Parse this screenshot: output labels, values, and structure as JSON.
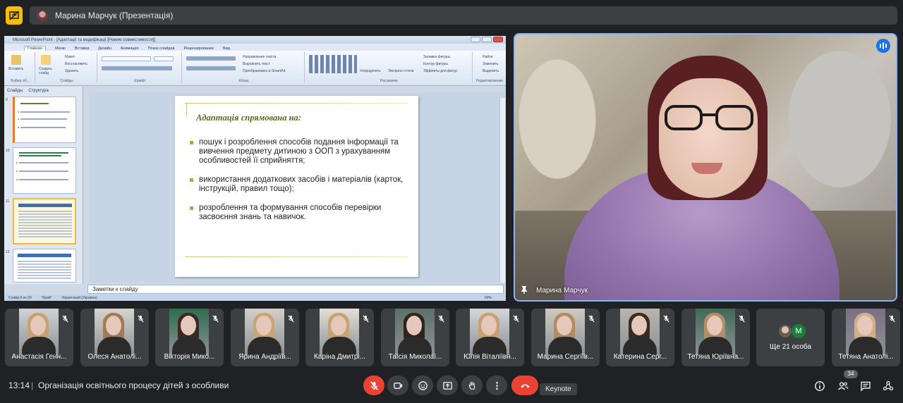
{
  "top_bar": {
    "presenter_title": "Марина Марчук (Презентація)"
  },
  "presentation": {
    "app_title": "Microsoft PowerPoint - [Адаптації та модифікації [Режим совместимости]]",
    "tabs": [
      "Главная",
      "Меню",
      "Вставка",
      "Дизайн",
      "Анимация",
      "Показ слайдов",
      "Рецензирование",
      "Вид"
    ],
    "ribbon": {
      "paste": "Вставить",
      "clipboard": "Буфер об...",
      "new_slide": "Создать слайд",
      "layout": "Макет",
      "reset": "Восстановить",
      "delete": "Удалить",
      "slides_group": "Слайды",
      "font_group": "Шрифт",
      "paragraph_group": "Абзац",
      "text_direction": "Направление текста",
      "align_text": "Выровнять текст",
      "smartart": "Преобразовать в SmartArt",
      "arrange": "Упорядочить",
      "quick_styles": "Экспресс-стили",
      "shape_fill": "Заливка фигуры",
      "shape_outline": "Контур фигуры",
      "shape_effects": "Эффекты для фигур",
      "drawing_group": "Рисование",
      "find": "Найти",
      "replace": "Заменить",
      "select": "Выделить",
      "editing_group": "Редактирование"
    },
    "pane_tabs": [
      "Слайды",
      "Структура"
    ],
    "thumb_numbers": [
      "9",
      "10",
      "11",
      "12"
    ],
    "slide": {
      "heading": "Адаптація спрямована на:",
      "bullets": [
        "пошук і розроблення способів подання інформації та вивчення предмету дитиною з ООП з урахуванням особливостей її сприйняття;",
        "використання додаткових засобів і матеріалів (карток, інструкцій, правил тощо);",
        "розроблення та формування способів перевірки засвоєння знань та навичок."
      ]
    },
    "notes_placeholder": "Заметки к слайду",
    "status": {
      "slide_counter": "Слайд 9 из 20",
      "theme": "\"Край\"",
      "language": "Украинский (Украина)",
      "zoom": "69%"
    }
  },
  "speaker": {
    "name": "Марина Марчук"
  },
  "participants": [
    "Анастасія Генн...",
    "Олеся Анатолі...",
    "Вікторія Мико...",
    "Ярина Андріїв...",
    "Каріна Дмитрі...",
    "Таїсія Миколаї...",
    "Юлія Віталіївн...",
    "Марина Сергіїв...",
    "Катерина Серг...",
    "Тетяна Юріївна...",
    "__MORE__",
    "Тетяна Анатолі..."
  ],
  "more_tile": {
    "avatar_letter": "M",
    "label": "Ще 21 особа"
  },
  "bottom_bar": {
    "time": "13:14",
    "separator": "|",
    "meeting_title": "Організація освітнього процесу дітей з особливи...",
    "tooltip": "Keynote",
    "participant_count": "34"
  },
  "colors": {
    "background": "#202124",
    "tile": "#3c4043",
    "danger": "#ea4335",
    "accent": "#8ab4f8",
    "present_badge": "#fbbc04"
  },
  "icons": [
    "present-icon",
    "mic-off-icon",
    "camera-icon",
    "emoji-icon",
    "present-screen-icon",
    "raise-hand-icon",
    "more-options-icon",
    "call-end-icon",
    "info-icon",
    "people-icon",
    "chat-icon",
    "activities-icon",
    "pin-icon",
    "speaking-icon"
  ]
}
